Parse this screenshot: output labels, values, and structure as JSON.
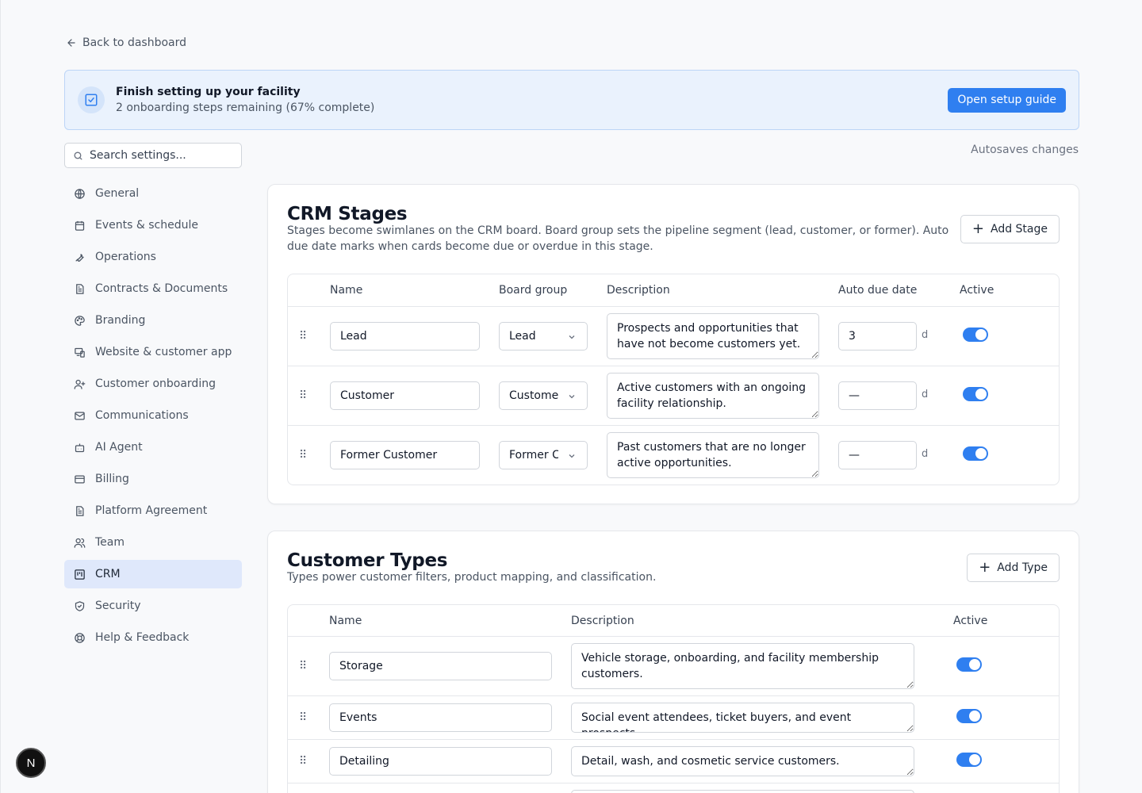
{
  "back_link": "Back to dashboard",
  "banner": {
    "title": "Finish setting up your facility",
    "subtitle": "2 onboarding steps remaining (67% complete)",
    "button": "Open setup guide"
  },
  "search": {
    "placeholder": "Search settings..."
  },
  "autosave": "Autosaves changes",
  "sidebar": {
    "items": [
      {
        "label": "General",
        "icon": "globe-icon"
      },
      {
        "label": "Events & schedule",
        "icon": "calendar-icon"
      },
      {
        "label": "Operations",
        "icon": "wrench-icon"
      },
      {
        "label": "Contracts & Documents",
        "icon": "document-icon"
      },
      {
        "label": "Branding",
        "icon": "palette-icon"
      },
      {
        "label": "Website & customer app",
        "icon": "devices-icon"
      },
      {
        "label": "Customer onboarding",
        "icon": "user-plus-icon"
      },
      {
        "label": "Communications",
        "icon": "mail-icon"
      },
      {
        "label": "AI Agent",
        "icon": "bot-icon"
      },
      {
        "label": "Billing",
        "icon": "credit-card-icon"
      },
      {
        "label": "Platform Agreement",
        "icon": "document-icon"
      },
      {
        "label": "Team",
        "icon": "users-icon"
      },
      {
        "label": "CRM",
        "icon": "kanban-icon"
      },
      {
        "label": "Security",
        "icon": "shield-icon"
      },
      {
        "label": "Help & Feedback",
        "icon": "lifebuoy-icon"
      }
    ],
    "active": "CRM"
  },
  "crm_stages": {
    "title": "CRM Stages",
    "description": "Stages become swimlanes on the CRM board. Board group sets the pipeline segment (lead, customer, or former). Auto due date marks when cards become due or overdue in this stage.",
    "add_button": "Add Stage",
    "columns": {
      "name": "Name",
      "board_group": "Board group",
      "description": "Description",
      "auto_due": "Auto due date",
      "active": "Active"
    },
    "due_suffix": "d",
    "rows": [
      {
        "name": "Lead",
        "board_group": "Lead",
        "description": "Prospects and opportunities that have not become customers yet.",
        "auto_due": "3",
        "active": true
      },
      {
        "name": "Customer",
        "board_group": "Customer",
        "description": "Active customers with an ongoing facility relationship.",
        "auto_due": "—",
        "active": true
      },
      {
        "name": "Former Customer",
        "board_group": "Former Customer",
        "description": "Past customers that are no longer active opportunities.",
        "auto_due": "—",
        "active": true
      }
    ]
  },
  "customer_types": {
    "title": "Customer Types",
    "description": "Types power customer filters, product mapping, and classification.",
    "add_button": "Add Type",
    "columns": {
      "name": "Name",
      "description": "Description",
      "active": "Active"
    },
    "rows": [
      {
        "name": "Storage",
        "description": "Vehicle storage, onboarding, and facility membership customers.",
        "active": true
      },
      {
        "name": "Events",
        "description": "Social event attendees, ticket buyers, and event prospects.",
        "active": true
      },
      {
        "name": "Detailing",
        "description": "Detail, wash, and cosmetic service customers.",
        "active": true
      }
    ]
  },
  "fab_label": "N",
  "colors": {
    "accent": "#2f7ff0",
    "active_nav": "#dfe8fb",
    "banner_bg": "#eaf2fd"
  }
}
